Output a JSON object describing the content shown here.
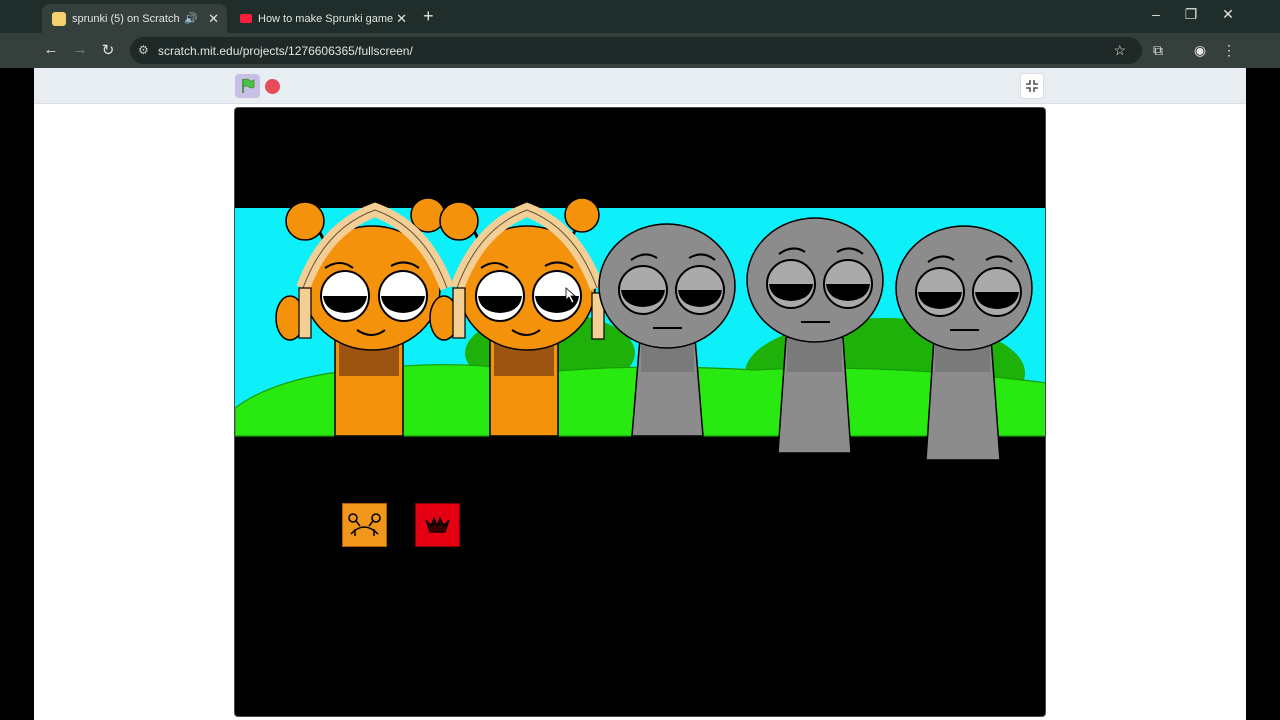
{
  "browser": {
    "tabs": [
      {
        "title": "sprunki (5) on Scratch",
        "active": true,
        "audio": true
      },
      {
        "title": "How to make Sprunki game in S",
        "active": false,
        "audio": false
      }
    ],
    "new_tab": "+",
    "window_controls": {
      "minimize": "–",
      "restore": "❐",
      "close": "✕"
    },
    "nav": {
      "back": "←",
      "forward": "→",
      "reload": "↻"
    },
    "url": "scratch.mit.edu/projects/1276606365/fullscreen/",
    "icons": {
      "tune": "site-info-icon",
      "star": "bookmark-star-icon"
    }
  },
  "scratch": {
    "controls": {
      "green_flag": "green-flag-icon",
      "stop": "stop-icon",
      "exit_fullscreen": "exit-fullscreen-icon"
    },
    "stage": {
      "sky_color": "#0df0fa",
      "grass_color": "#29ea10",
      "characters": [
        {
          "kind": "orange-headphones"
        },
        {
          "kind": "orange-headphones"
        },
        {
          "kind": "gray"
        },
        {
          "kind": "gray"
        },
        {
          "kind": "gray"
        }
      ],
      "sound_buttons": [
        {
          "color": "#f0961b",
          "icon": "orange-character-icon"
        },
        {
          "color": "#e40012",
          "icon": "red-character-icon"
        }
      ]
    }
  }
}
